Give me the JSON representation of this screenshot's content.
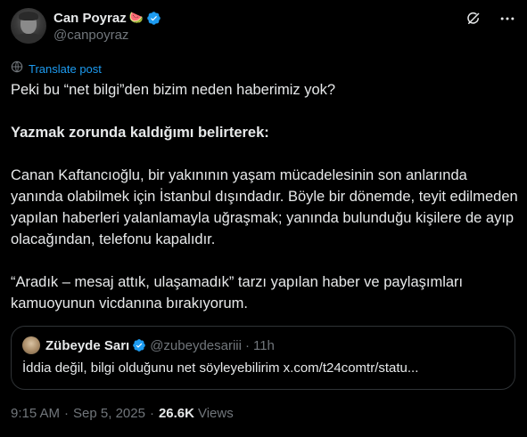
{
  "author": {
    "display_name": "Can Poyraz",
    "emoji": "🍉",
    "handle": "@canpoyraz"
  },
  "translate_label": "Translate post",
  "tweet": {
    "paragraphs": [
      "Peki bu “net bilgi”den bizim neden haberimiz yok?",
      "Yazmak zorunda kaldığımı belirterek:",
      "Canan Kaftancıoğlu, bir yakınının yaşam mücadelesinin son anlarında yanında olabilmek için İstanbul dışındadır. Böyle bir dönemde, teyit edilmeden yapılan haberleri yalanlamayla uğraşmak; yanında bulunduğu kişilere de ayıp olacağından, telefonu kapalıdır.",
      "“Aradık – mesaj attık, ulaşamadık” tarzı yapılan haber ve paylaşımları kamuoyunun vicdanına bırakıyorum."
    ]
  },
  "quote": {
    "display_name": "Zübeyde Sarı",
    "handle": "@zubeydesariii",
    "time": "11h",
    "text": "İddia değil, bilgi olduğunu net söyleyebilirim x.com/t24comtr/statu..."
  },
  "meta": {
    "time": "9:15 AM",
    "date": "Sep 5, 2025",
    "views_count": "26.6K",
    "views_label": "Views"
  },
  "colors": {
    "accent": "#1d9bf0",
    "secondary_text": "#71767b",
    "primary_text": "#e7e9ea",
    "border": "#2f3336",
    "background": "#000000"
  },
  "icons": {
    "verified": "verified-badge-icon",
    "grok": "grok-icon",
    "more": "more-options-icon",
    "translate": "translate-icon"
  }
}
